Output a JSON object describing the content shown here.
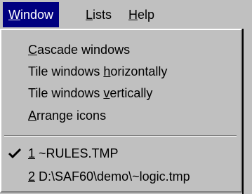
{
  "menubar": {
    "items": [
      {
        "accel": "W",
        "rest": "indow"
      },
      {
        "accel": "L",
        "rest": "ists"
      },
      {
        "accel": "H",
        "rest": "elp"
      }
    ]
  },
  "window_menu": {
    "items": [
      {
        "pre": "",
        "accel": "C",
        "post": "ascade windows"
      },
      {
        "pre": "Tile windows ",
        "accel": "h",
        "post": "orizontally"
      },
      {
        "pre": "Tile windows ",
        "accel": "v",
        "post": "ertically"
      },
      {
        "pre": "",
        "accel": "A",
        "post": "rrange icons"
      }
    ],
    "windows": [
      {
        "accel": "1",
        "post": " ~RULES.TMP",
        "checked": true
      },
      {
        "accel": "2",
        "post": " D:\\SAF60\\demo\\~logic.tmp",
        "checked": false
      }
    ]
  }
}
